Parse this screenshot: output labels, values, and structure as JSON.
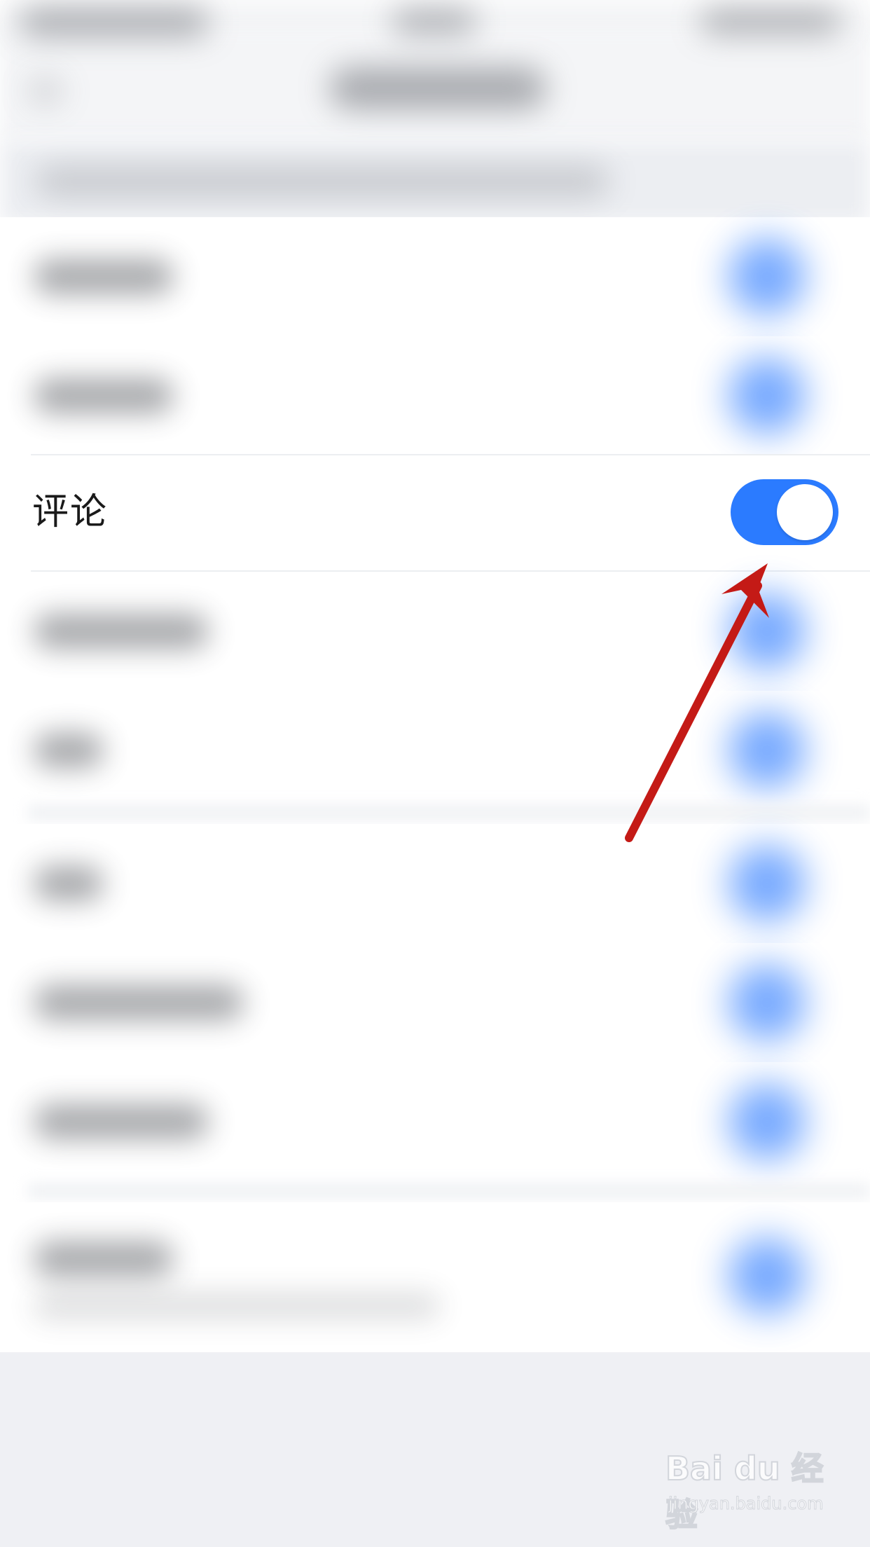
{
  "setting": {
    "label": "评论",
    "enabled": true
  },
  "colors": {
    "toggle_on": "#2b7bff",
    "arrow": "#c41a16",
    "label_text": "#1a1a1a"
  },
  "watermark": {
    "logo": "Bai du 经验",
    "url": "jingyan.baidu.com"
  },
  "icons": {
    "annotation": "red-arrow-icon"
  }
}
